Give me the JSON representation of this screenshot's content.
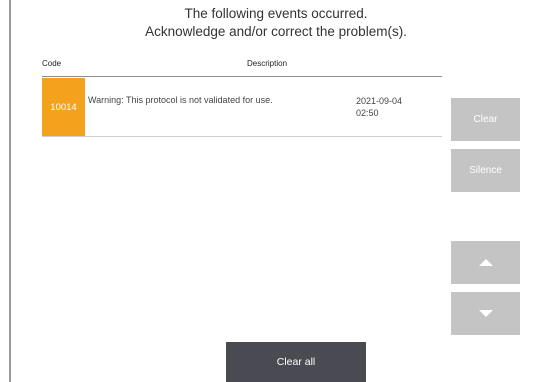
{
  "header": {
    "line1": "The following events occurred.",
    "line2": "Acknowledge and/or correct the problem(s)."
  },
  "table": {
    "columns": [
      "Code",
      "Description"
    ],
    "rows": [
      {
        "code": "10014",
        "description": "Warning: This protocol is not validated for use.",
        "date": "2021-09-04",
        "time": "02:50",
        "severity_color": "#f4a21e"
      }
    ]
  },
  "actions": {
    "clear": "Clear",
    "silence": "Silence",
    "clear_all": "Clear all",
    "scroll_up_icon": "up-triangle",
    "scroll_down_icon": "down-triangle"
  },
  "colors": {
    "disabled_button": "#c4c4c4",
    "primary_button": "#4a4b52",
    "warning": "#f4a21e"
  }
}
